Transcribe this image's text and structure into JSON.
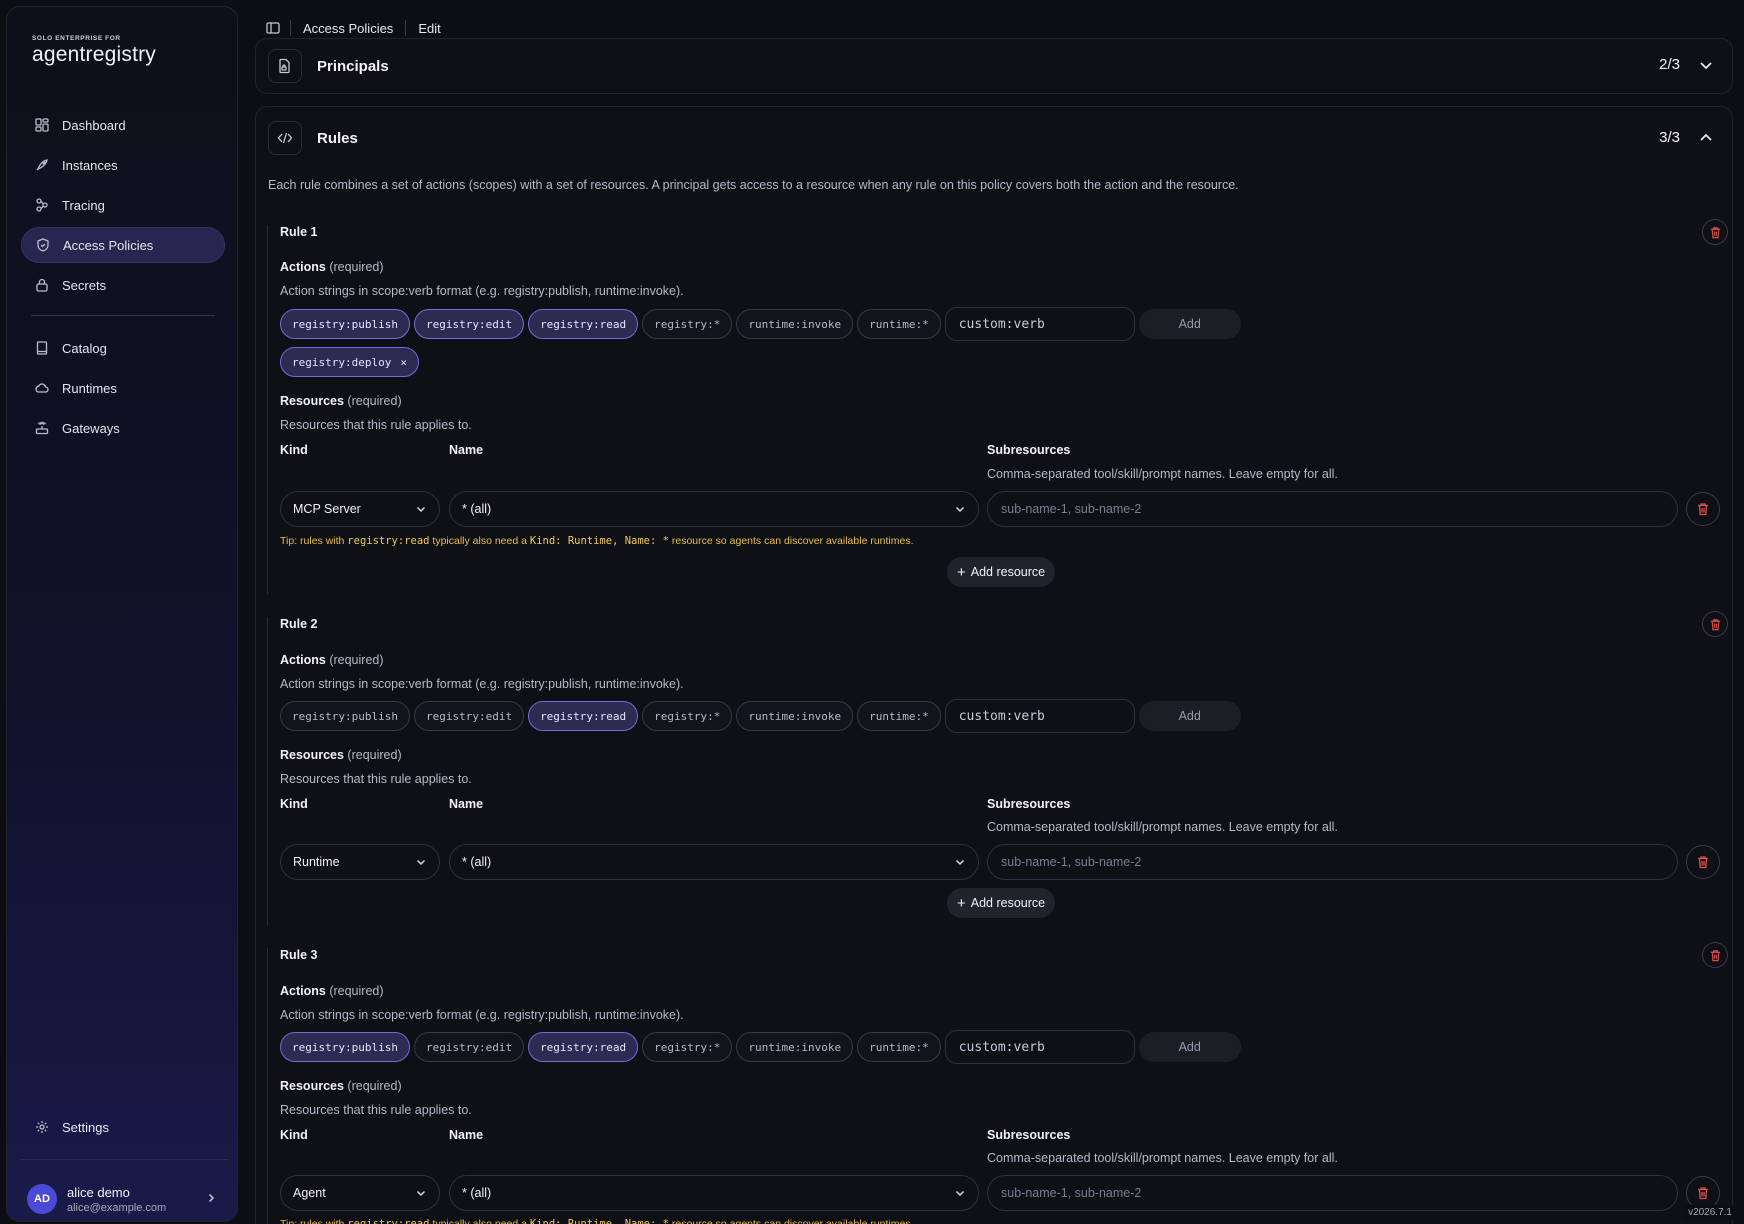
{
  "brand": {
    "small": "SOLO ENTERPRISE FOR",
    "name": "agentregistry"
  },
  "nav": {
    "main": [
      {
        "label": "Dashboard",
        "icon": "grid-icon"
      },
      {
        "label": "Instances",
        "icon": "rocket-icon"
      },
      {
        "label": "Tracing",
        "icon": "nodes-icon"
      },
      {
        "label": "Access Policies",
        "icon": "shield-icon",
        "active": true
      },
      {
        "label": "Secrets",
        "icon": "lock-icon"
      }
    ],
    "secondary": [
      {
        "label": "Catalog",
        "icon": "book-icon"
      },
      {
        "label": "Runtimes",
        "icon": "cloud-icon"
      },
      {
        "label": "Gateways",
        "icon": "router-icon"
      }
    ],
    "settings": "Settings"
  },
  "user": {
    "initials": "AD",
    "name": "alice demo",
    "email": "alice@example.com"
  },
  "breadcrumb": {
    "page": "Access Policies",
    "action": "Edit"
  },
  "principals": {
    "title": "Principals",
    "count": "2/3"
  },
  "rules_section": {
    "title": "Rules",
    "count": "3/3",
    "description": "Each rule combines a set of actions (scopes) with a set of resources. A principal gets access to a resource when any rule on this policy covers both the action and the resource."
  },
  "labels": {
    "actions": "Actions",
    "resources": "Resources",
    "required": "(required)",
    "actions_hint": "Action strings in scope:verb format (e.g. registry:publish, runtime:invoke).",
    "resources_hint": "Resources that this rule applies to.",
    "kind": "Kind",
    "name": "Name",
    "subresources": "Subresources",
    "subresources_hint": "Comma-separated tool/skill/prompt names. Leave empty for all.",
    "custom_placeholder": "custom:verb",
    "add": "Add",
    "subresource_placeholder": "sub-name-1, sub-name-2",
    "add_resource": "Add resource"
  },
  "tip": {
    "prefix": "Tip: rules with ",
    "code1": "registry:read",
    "mid": " typically also need a ",
    "code2": "Kind: Runtime, Name: *",
    "suffix": " resource so agents can discover available runtimes."
  },
  "rules": [
    {
      "title": "Rule 1",
      "chips": [
        {
          "label": "registry:publish",
          "on": true
        },
        {
          "label": "registry:edit",
          "on": true
        },
        {
          "label": "registry:read",
          "on": true
        },
        {
          "label": "registry:*",
          "on": false
        },
        {
          "label": "runtime:invoke",
          "on": false
        },
        {
          "label": "runtime:*",
          "on": false
        }
      ],
      "custom_chips": [
        {
          "label": "registry:deploy",
          "remove": "×"
        }
      ],
      "resource": {
        "kind": "MCP Server",
        "name": "* (all)"
      },
      "show_tip": true
    },
    {
      "title": "Rule 2",
      "chips": [
        {
          "label": "registry:publish",
          "on": false
        },
        {
          "label": "registry:edit",
          "on": false
        },
        {
          "label": "registry:read",
          "on": true
        },
        {
          "label": "registry:*",
          "on": false
        },
        {
          "label": "runtime:invoke",
          "on": false
        },
        {
          "label": "runtime:*",
          "on": false
        }
      ],
      "resource": {
        "kind": "Runtime",
        "name": "* (all)"
      },
      "show_tip": false
    },
    {
      "title": "Rule 3",
      "chips": [
        {
          "label": "registry:publish",
          "on": true
        },
        {
          "label": "registry:edit",
          "on": false
        },
        {
          "label": "registry:read",
          "on": true
        },
        {
          "label": "registry:*",
          "on": false
        },
        {
          "label": "runtime:invoke",
          "on": false
        },
        {
          "label": "runtime:*",
          "on": false
        }
      ],
      "resource": {
        "kind": "Agent",
        "name": "* (all)"
      },
      "show_tip": true
    }
  ],
  "version": "v2026.7.1",
  "colors": {
    "accent": "#7868d8",
    "active_nav": "#262650",
    "danger": "#e05050",
    "tip": "#e8c040"
  }
}
